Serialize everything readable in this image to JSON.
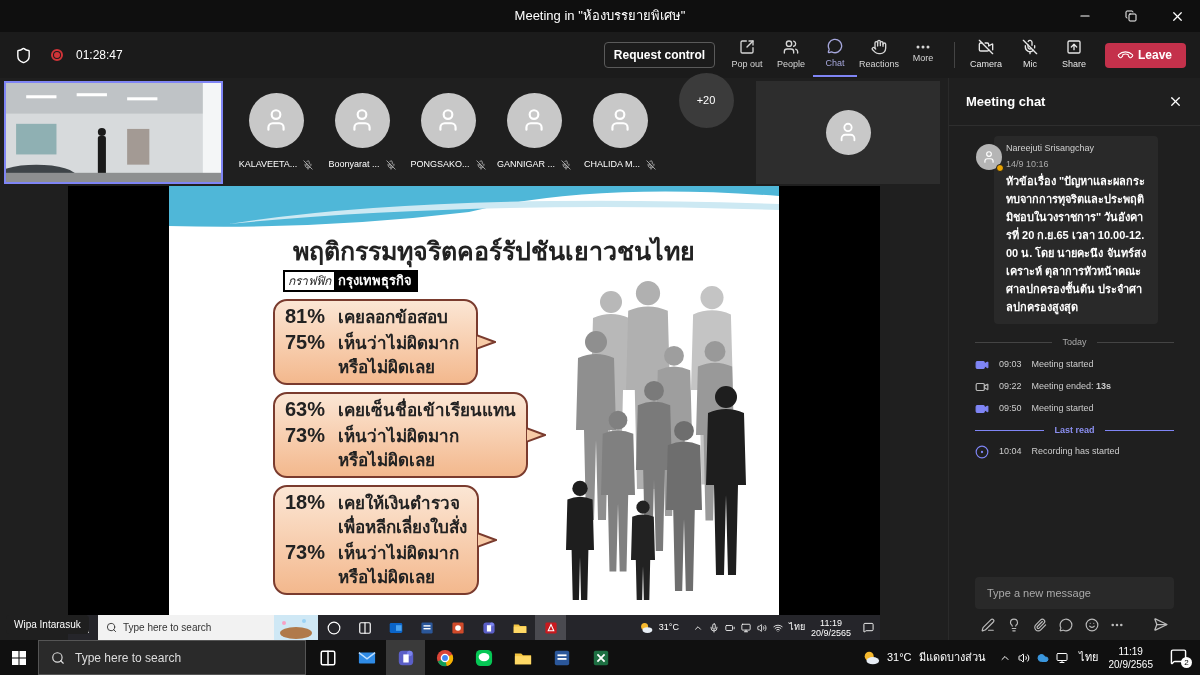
{
  "window": {
    "title": "Meeting in \"ห้องบรรยายพิเศษ\""
  },
  "toolbar": {
    "recording": true,
    "timer": "01:28:47",
    "request_control": "Request control",
    "view_buttons": [
      {
        "label": "Pop out",
        "kind": "popout",
        "selected": false
      },
      {
        "label": "People",
        "kind": "people",
        "selected": false
      },
      {
        "label": "Chat",
        "kind": "chat",
        "selected": true
      },
      {
        "label": "Reactions",
        "kind": "reactions",
        "selected": false
      },
      {
        "label": "More",
        "kind": "more",
        "selected": false
      }
    ],
    "device_buttons": [
      {
        "label": "Camera",
        "kind": "camera",
        "on": false
      },
      {
        "label": "Mic",
        "kind": "mic",
        "on": false
      },
      {
        "label": "Share",
        "kind": "share"
      }
    ],
    "leave": "Leave"
  },
  "participants": [
    {
      "name": "KALAVEETA...",
      "muted": true
    },
    {
      "name": "Boonyarat ...",
      "muted": true
    },
    {
      "name": "PONGSAKO...",
      "muted": true
    },
    {
      "name": "GANNIGAR ...",
      "muted": true
    },
    {
      "name": "CHALIDA M...",
      "muted": true
    }
  ],
  "overflow_count": "+20",
  "shared_screen": {
    "presenter": "Wipa Intarasuk",
    "slide": {
      "title": "พฤติกรรมทุจริตคอร์รัปชันเยาวชนไทย",
      "source": [
        "กราฟฟิก",
        "กรุงเทพธุรกิจ"
      ],
      "bubbles": [
        {
          "lines": [
            {
              "percent": "81%",
              "text": "เคยลอกข้อสอบ"
            },
            {
              "percent": "75%",
              "text": "เห็นว่าไม่ผิดมาก"
            },
            {
              "text": "หรือไม่ผิดเลย"
            }
          ]
        },
        {
          "lines": [
            {
              "percent": "63%",
              "text": "เคยเซ็นชื่อเข้าเรียนแทน"
            },
            {
              "percent": "73%",
              "text": "เห็นว่าไม่ผิดมาก"
            },
            {
              "text": "หรือไม่ผิดเลย"
            }
          ]
        },
        {
          "lines": [
            {
              "percent": "18%",
              "text": "เคยให้เงินตำรวจ"
            },
            {
              "text": "เพื่อหลีกเลี่ยงใบสั่ง"
            },
            {
              "percent": "73%",
              "text": "เห็นว่าไม่ผิดมาก"
            },
            {
              "text": "หรือไม่ผิดเลย"
            }
          ]
        }
      ]
    },
    "taskbar": {
      "search_placeholder": "Type here to search",
      "apps": [
        {
          "kind": "cortana",
          "active": false
        },
        {
          "kind": "taskview",
          "active": false
        },
        {
          "kind": "outlook",
          "active": false
        },
        {
          "kind": "word",
          "active": false
        },
        {
          "kind": "powerpoint",
          "active": false
        },
        {
          "kind": "teams",
          "active": false
        },
        {
          "kind": "folder",
          "active": false
        },
        {
          "kind": "pdf",
          "active": true
        }
      ],
      "temperature": "31°C",
      "language": "ไทย",
      "time": "11:19",
      "date": "20/9/2565"
    }
  },
  "chat": {
    "title": "Meeting chat",
    "message": {
      "author": "Nareejuti Srisangchay",
      "time": "14/9 10:16",
      "text": "หัวข้อเรื่อง \"ปัญหาและผลกระทบจากการทุจริตและประพฤติมิชอบในวงราชการ\" วันอังคารที่ 20 ก.ย.65 เวลา 10.00-12.00 น. โดย นายคะนึง จันทร์สงเคราะห์ ตุลาการหัวหน้าคณะศาลปกครองชั้นต้น ประจำศาลปกครองสูงสุด"
    },
    "timeline": [
      {
        "kind": "divider",
        "label": "Today",
        "highlight": false
      },
      {
        "kind": "started",
        "time": "09:03",
        "text": "Meeting started"
      },
      {
        "kind": "ended",
        "time": "09:22",
        "text": "Meeting ended: **13s**"
      },
      {
        "kind": "started",
        "time": "09:50",
        "text": "Meeting started"
      },
      {
        "kind": "divider",
        "label": "Last read",
        "highlight": true
      },
      {
        "kind": "recording",
        "time": "10:04",
        "text": "Recording has started"
      }
    ],
    "composer_placeholder": "Type a new message"
  },
  "taskbar": {
    "search_placeholder": "Type here to search",
    "apps": [
      {
        "kind": "taskview",
        "active": false
      },
      {
        "kind": "mail",
        "active": false
      },
      {
        "kind": "teams",
        "active": true
      },
      {
        "kind": "chrome",
        "active": false
      },
      {
        "kind": "line",
        "active": false
      },
      {
        "kind": "folder",
        "active": false
      },
      {
        "kind": "word",
        "active": false
      },
      {
        "kind": "excel",
        "active": false
      }
    ],
    "temperature": "31°C",
    "weather": "มีแดดบางส่วน",
    "language": "ไทย",
    "time": "11:19",
    "date": "20/9/2565",
    "notifications": "2"
  }
}
